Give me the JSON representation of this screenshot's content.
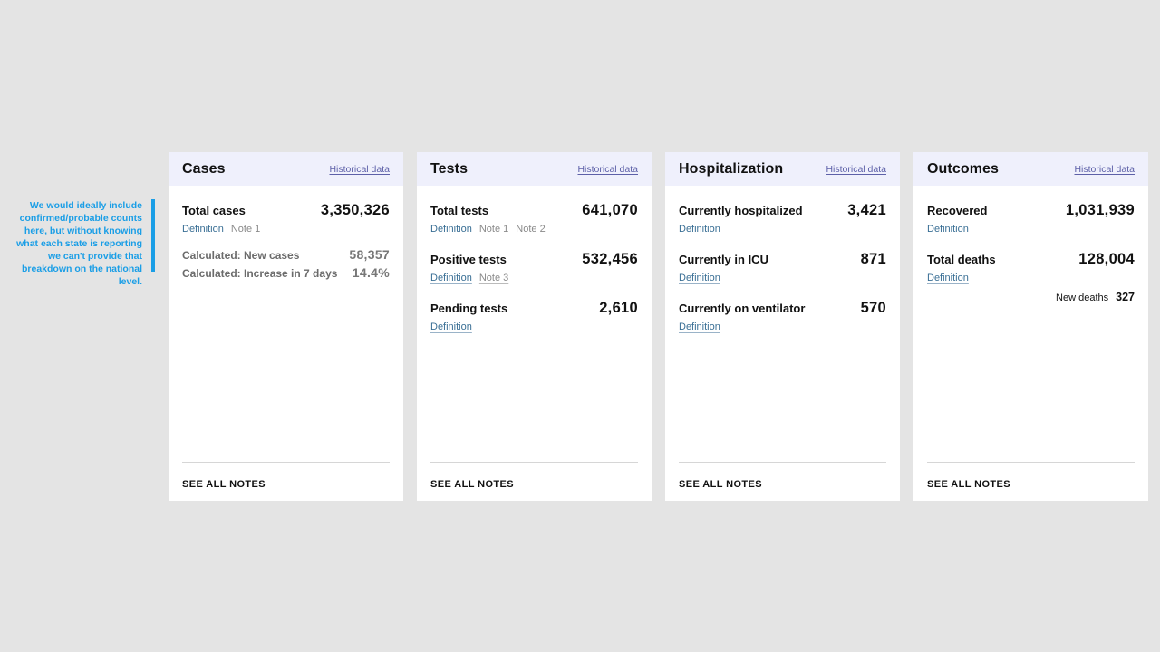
{
  "annotation": {
    "text": "We would ideally include confirmed/probable counts here, but without knowing what each state is reporting we can't provide that breakdown on the national level.",
    "color": "#1a9ee6"
  },
  "colors": {
    "background": "#e4e4e4",
    "header_bg": "#eff0fc",
    "link": "#5d60a8"
  },
  "cards": [
    {
      "title": "Cases",
      "historical": "Historical data",
      "metrics": [
        {
          "label": "Total cases",
          "value": "3,350,326",
          "definition": "Definition",
          "notes": [
            "Note 1"
          ]
        }
      ],
      "calculated": [
        {
          "label": "Calculated: New cases",
          "value": "58,357"
        },
        {
          "label": "Calculated: Increase in 7 days",
          "value": "14.4%"
        }
      ],
      "footer": "SEE ALL NOTES"
    },
    {
      "title": "Tests",
      "historical": "Historical data",
      "metrics": [
        {
          "label": "Total tests",
          "value": "641,070",
          "definition": "Definition",
          "notes": [
            "Note 1",
            "Note 2"
          ]
        },
        {
          "label": "Positive tests",
          "value": "532,456",
          "definition": "Definition",
          "notes": [
            "Note 3"
          ]
        },
        {
          "label": "Pending tests",
          "value": "2,610",
          "definition": "Definition",
          "notes": []
        }
      ],
      "footer": "SEE ALL NOTES"
    },
    {
      "title": "Hospitalization",
      "historical": "Historical data",
      "metrics": [
        {
          "label": "Currently hospitalized",
          "value": "3,421",
          "definition": "Definition",
          "notes": []
        },
        {
          "label": "Currently in ICU",
          "value": "871",
          "definition": "Definition",
          "notes": []
        },
        {
          "label": "Currently on ventilator",
          "value": "570",
          "definition": "Definition",
          "notes": []
        }
      ],
      "footer": "SEE ALL NOTES"
    },
    {
      "title": "Outcomes",
      "historical": "Historical data",
      "metrics": [
        {
          "label": "Recovered",
          "value": "1,031,939",
          "definition": "Definition",
          "notes": []
        },
        {
          "label": "Total deaths",
          "value": "128,004",
          "definition": "Definition",
          "notes": []
        }
      ],
      "sub": {
        "label": "New deaths",
        "value": "327"
      },
      "footer": "SEE ALL NOTES"
    }
  ]
}
